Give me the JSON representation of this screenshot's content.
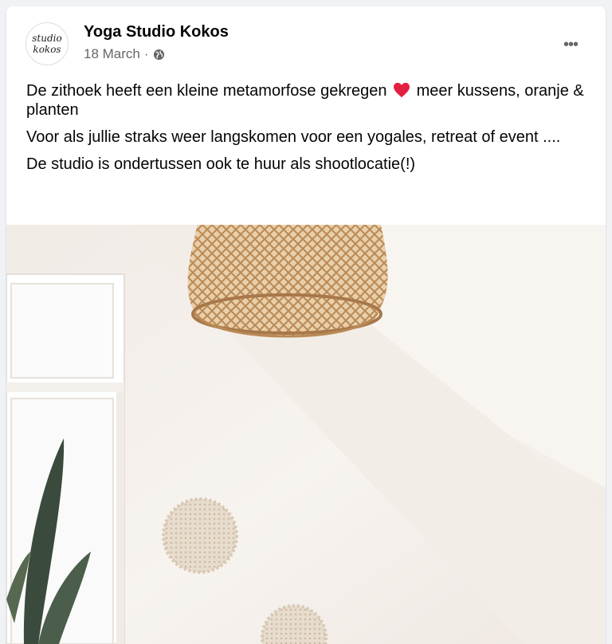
{
  "post": {
    "page_name": "Yoga Studio Kokos",
    "avatar_text": [
      "studio",
      "kokos"
    ],
    "date": "18 March",
    "separator": "·",
    "privacy_icon": "globe-icon",
    "more_label": "•••",
    "paragraphs": [
      {
        "before_emoji": "De zithoek heeft een kleine metamorfose gekregen",
        "emoji": "heart-icon",
        "after_emoji": "meer kussens, oranje & planten"
      },
      {
        "text": "Voor als jullie straks weer langskomen voor een yogales, retreat of event ...."
      },
      {
        "text": "De studio is ondertussen ook te huur als shootlocatie(!)"
      }
    ],
    "image_description": "photo",
    "colors": {
      "background": "#f0f2f5",
      "card": "#ffffff",
      "name": "#050505",
      "meta": "#65676b",
      "heart": "#e41e3f"
    }
  }
}
